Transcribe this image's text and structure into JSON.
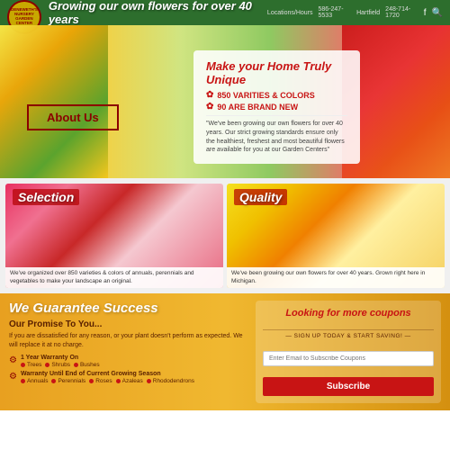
{
  "header": {
    "logo_text": "DENEWETH'S\nNURSERY\nGARDEN CENTER",
    "tagline": "Growing our own flowers for over 40 years",
    "phone1_label": "Locations/Hours",
    "phone1": "586-247-5533",
    "phone2_label": "Hartfield",
    "phone2": "248-714-1720"
  },
  "hero": {
    "title_normal": "Make your Home ",
    "title_highlight": "Truly Unique",
    "feature1": "850 VARITIES & COLORS",
    "feature2": "90 ARE BRAND NEW",
    "description": "\"We've been growing our own flowers for over 40 years. Our strict growing standards ensure only the healthiest, freshest and most beautiful flowers are available for you at our Garden Centers\"",
    "about_btn": "About Us"
  },
  "sections": [
    {
      "id": "selection",
      "label": "Selection",
      "description": "We've organized over 850 varieties & colors of annuals, perennials and vegetables to make your landscape an original."
    },
    {
      "id": "quality",
      "label": "Quality",
      "description": "We've been growing our own flowers for over 40 years. Grown right here in Michigan."
    }
  ],
  "guarantee": {
    "title": "We Guarantee Success",
    "promise_title": "Our Promise To You...",
    "promise_text": "If you are dissatisfied for any reason, or your plant doesn't perform as expected. We will replace it at no charge.",
    "warranty1_title": "1 Year Warranty On",
    "warranty1_items": [
      "Trees",
      "Shrubs",
      "Bushes"
    ],
    "warranty2_title": "Warranty Until End of Current Growing Season",
    "warranty2_items": [
      "Annuals",
      "Perennials",
      "Roses",
      "Azaleas",
      "Rhododendrons"
    ],
    "coupon_title_normal": "Looking for ",
    "coupon_title_highlight": "more",
    "coupon_title_end": " coupons",
    "coupon_subtitle": "— SIGN UP TODAY & START SAVING! —",
    "email_placeholder": "Enter Email to Subscribe Coupons",
    "subscribe_btn": "Subscribe"
  },
  "colors": {
    "brand_red": "#8b0000",
    "brand_green": "#2d6e2d",
    "brand_gold": "#c8a800",
    "highlight_red": "#c81414",
    "text_dark": "#5a2000"
  }
}
